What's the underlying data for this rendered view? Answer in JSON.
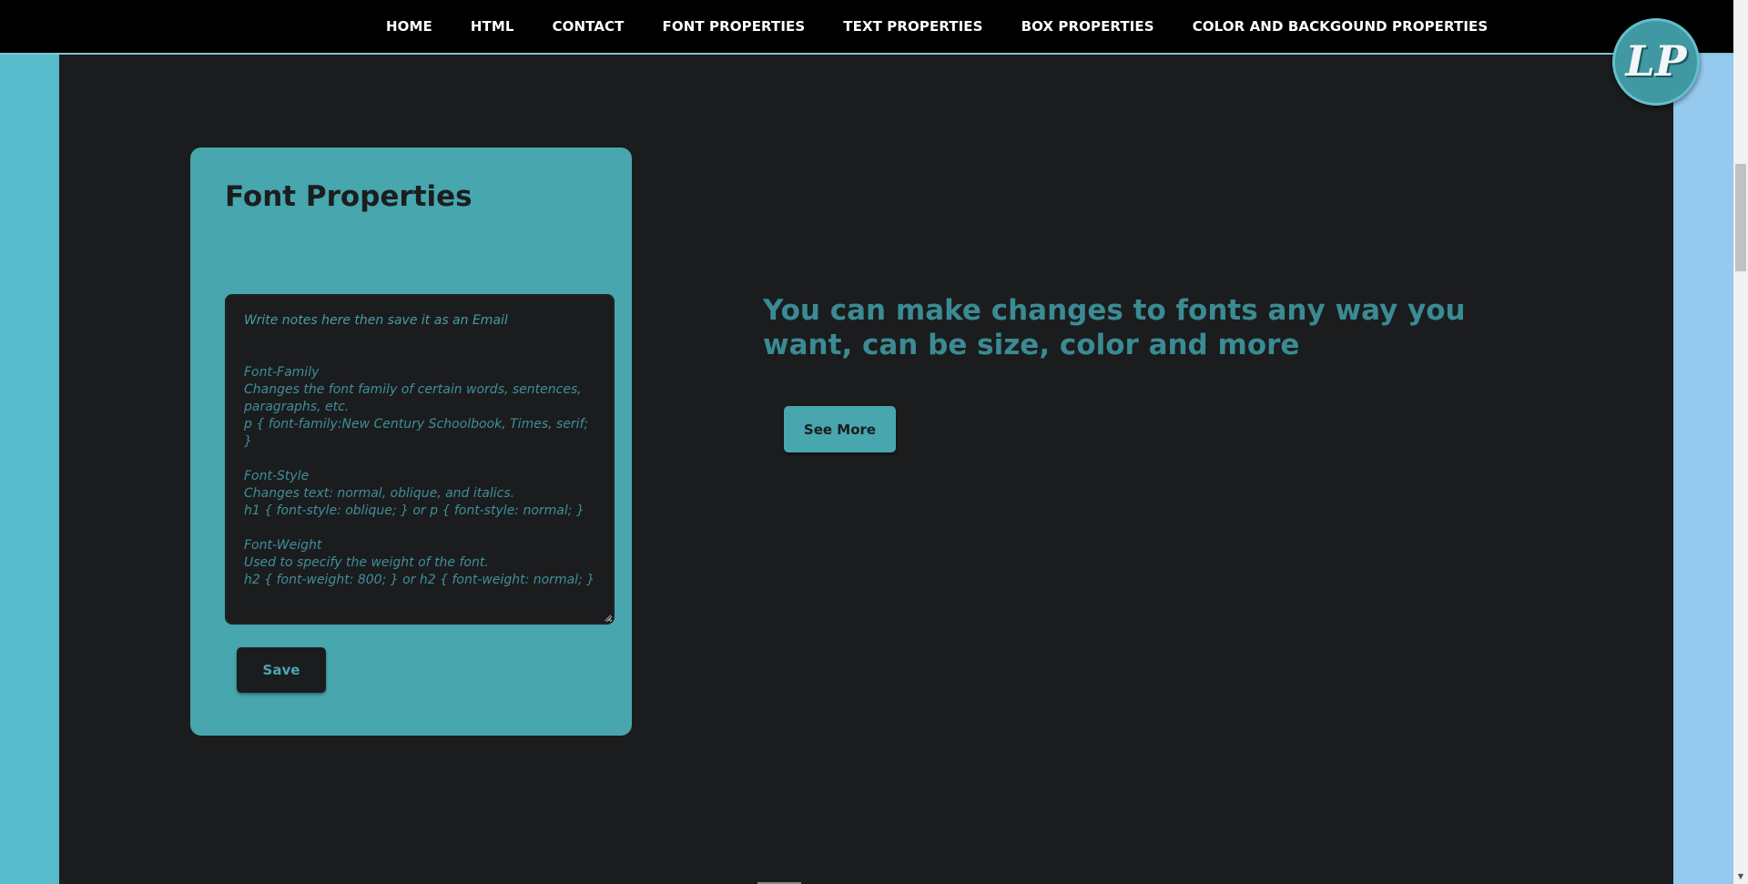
{
  "nav": {
    "items": [
      {
        "label": "HOME"
      },
      {
        "label": "HTML"
      },
      {
        "label": "CONTACT"
      },
      {
        "label": "FONT PROPERTIES"
      },
      {
        "label": "TEXT PROPERTIES"
      },
      {
        "label": "BOX PROPERTIES"
      },
      {
        "label": "COLOR AND BACKGOUND PROPERTIES"
      }
    ]
  },
  "logo": {
    "text": "LP",
    "icon": "lp-monogram-logo"
  },
  "card": {
    "title": "Font Properties",
    "notes_placeholder": "Write notes here then save it as an Email",
    "notes_value": "Font-Family\nChanges the font family of certain words, sentences, paragraphs, etc.\np { font-family:New Century Schoolbook, Times, serif; }\n\nFont-Style\nChanges text: normal, oblique, and italics.\nh1 { font-style: oblique; } or p { font-style: normal; }\n\nFont-Weight\nUsed to specify the weight of the font.\nh2 { font-weight: 800; } or h2 { font-weight: normal; }",
    "save_label": "Save"
  },
  "hero": {
    "headline": "You can make changes to fonts any way you want, can be size, color and more",
    "button_label": "See More"
  },
  "colors": {
    "accent": "#47a6ae",
    "background": "#1b1c1e",
    "navbar": "#000000",
    "left_band": "#56bccb",
    "right_band": "#95c9ee"
  }
}
